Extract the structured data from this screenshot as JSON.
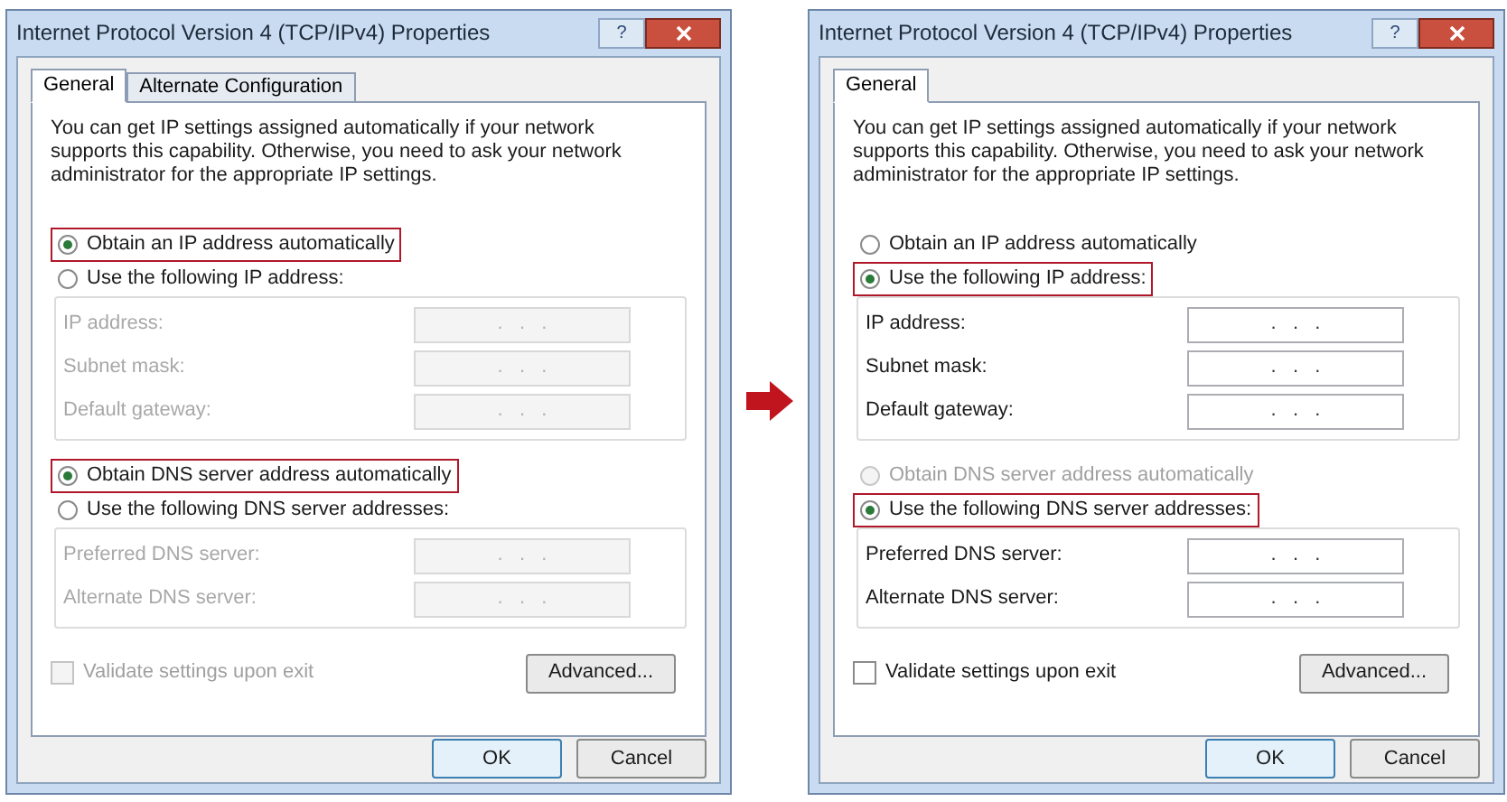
{
  "dialogs": [
    {
      "title": "Internet Protocol Version 4 (TCP/IPv4) Properties",
      "help_button": "?",
      "tabs": [
        {
          "label": "General",
          "selected": true
        },
        {
          "label": "Alternate Configuration",
          "selected": false
        }
      ],
      "description": "You can get IP settings assigned automatically if your network supports this capability. Otherwise, you need to ask your network administrator for the appropriate IP settings.",
      "ip_options": [
        {
          "label": "Obtain an IP address automatically",
          "selected": true,
          "disabled": false,
          "highlighted": true
        },
        {
          "label": "Use the following IP address:",
          "selected": false,
          "disabled": false,
          "highlighted": false
        }
      ],
      "ip_fields": [
        {
          "label": "IP address:",
          "value": ".   .   .",
          "disabled": true
        },
        {
          "label": "Subnet mask:",
          "value": ".   .   .",
          "disabled": true
        },
        {
          "label": "Default gateway:",
          "value": ".   .   .",
          "disabled": true
        }
      ],
      "dns_options": [
        {
          "label": "Obtain DNS server address automatically",
          "selected": true,
          "disabled": false,
          "highlighted": true
        },
        {
          "label": "Use the following DNS server addresses:",
          "selected": false,
          "disabled": false,
          "highlighted": false
        }
      ],
      "dns_fields": [
        {
          "label": "Preferred DNS server:",
          "value": ".   .   .",
          "disabled": true
        },
        {
          "label": "Alternate DNS server:",
          "value": ".   .   .",
          "disabled": true
        }
      ],
      "validate": {
        "label": "Validate settings upon exit",
        "checked": false,
        "disabled": true
      },
      "advanced_button": "Advanced...",
      "ok_button": "OK",
      "cancel_button": "Cancel"
    },
    {
      "title": "Internet Protocol Version 4 (TCP/IPv4) Properties",
      "help_button": "?",
      "tabs": [
        {
          "label": "General",
          "selected": true
        }
      ],
      "description": "You can get IP settings assigned automatically if your network supports this capability. Otherwise, you need to ask your network administrator for the appropriate IP settings.",
      "ip_options": [
        {
          "label": "Obtain an IP address automatically",
          "selected": false,
          "disabled": false,
          "highlighted": false
        },
        {
          "label": "Use the following IP address:",
          "selected": true,
          "disabled": false,
          "highlighted": true
        }
      ],
      "ip_fields": [
        {
          "label": "IP address:",
          "value": ".   .   .",
          "disabled": false
        },
        {
          "label": "Subnet mask:",
          "value": ".   .   .",
          "disabled": false
        },
        {
          "label": "Default gateway:",
          "value": ".   .   .",
          "disabled": false
        }
      ],
      "dns_options": [
        {
          "label": "Obtain DNS server address automatically",
          "selected": false,
          "disabled": true,
          "highlighted": false
        },
        {
          "label": "Use the following DNS server addresses:",
          "selected": true,
          "disabled": false,
          "highlighted": true
        }
      ],
      "dns_fields": [
        {
          "label": "Preferred DNS server:",
          "value": ".   .   .",
          "disabled": false
        },
        {
          "label": "Alternate DNS server:",
          "value": ".   .   .",
          "disabled": false
        }
      ],
      "validate": {
        "label": "Validate settings upon exit",
        "checked": false,
        "disabled": false
      },
      "advanced_button": "Advanced...",
      "ok_button": "OK",
      "cancel_button": "Cancel"
    }
  ]
}
